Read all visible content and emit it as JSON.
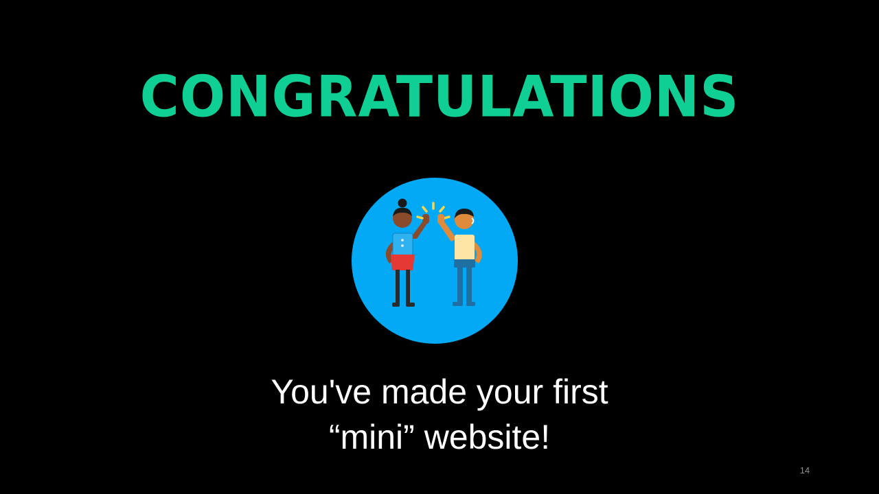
{
  "slide": {
    "title": "CONGRATULATIONS",
    "message_line_1": "You've made your first",
    "message_line_2": "“mini” website!",
    "page_number": "14"
  },
  "illustration": {
    "icon": "high-five-icon",
    "circle_color": "#03a9f4"
  },
  "colors": {
    "background": "#000000",
    "title": "#10cf95",
    "message": "#ffffff",
    "page_number": "#8c8c8c"
  }
}
